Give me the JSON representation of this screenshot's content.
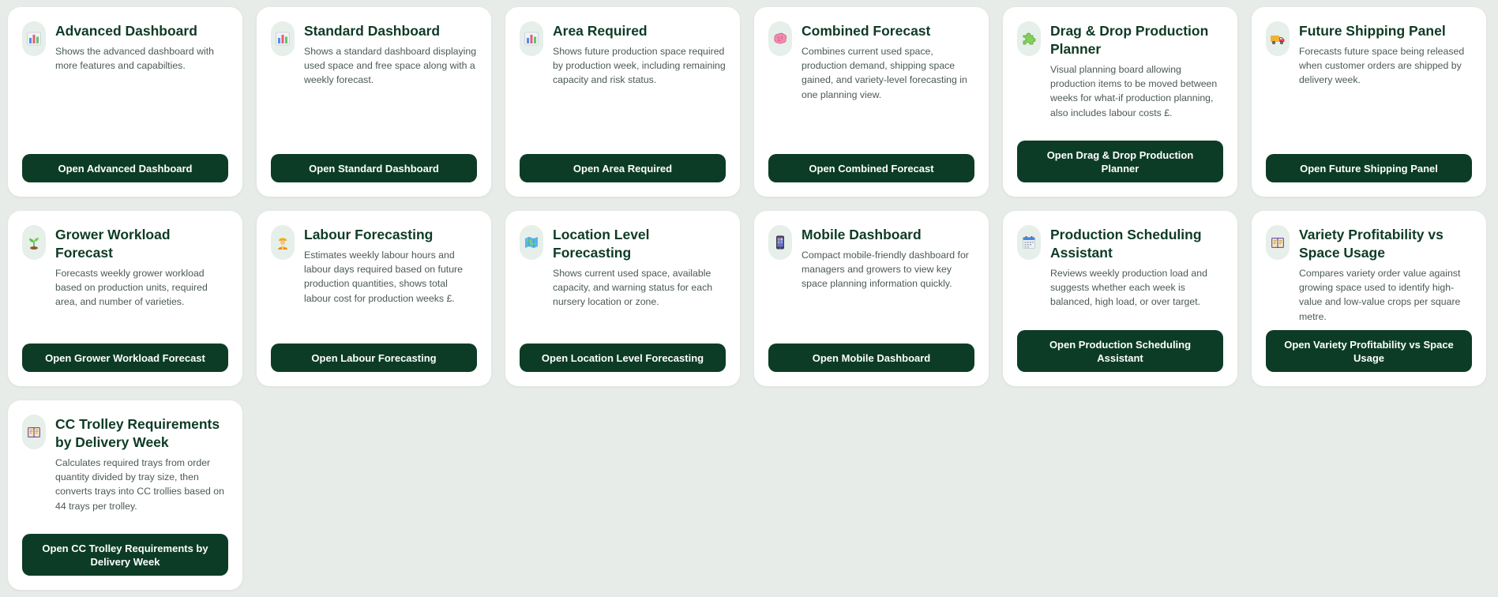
{
  "cards": [
    {
      "icon": "bar-chart-icon",
      "title": "Advanced Dashboard",
      "description": "Shows the advanced dashboard with more features and capabilties.",
      "button": "Open Advanced Dashboard"
    },
    {
      "icon": "bar-chart-icon",
      "title": "Standard Dashboard",
      "description": "Shows a standard dashboard displaying used space and free space along with a weekly forecast.",
      "button": "Open Standard Dashboard"
    },
    {
      "icon": "bar-chart-icon",
      "title": "Area Required",
      "description": "Shows future production space required by production week, including remaining capacity and risk status.",
      "button": "Open Area Required"
    },
    {
      "icon": "brain-icon",
      "title": "Combined Forecast",
      "description": "Combines current used space, production demand, shipping space gained, and variety-level forecasting in one planning view.",
      "button": "Open Combined Forecast"
    },
    {
      "icon": "puzzle-icon",
      "title": "Drag & Drop Production Planner",
      "description": "Visual planning board allowing production items to be moved between weeks for what-if production planning, also includes labour costs £.",
      "button": "Open Drag & Drop Production Planner"
    },
    {
      "icon": "truck-icon",
      "title": "Future Shipping Panel",
      "description": "Forecasts future space being released when customer orders are shipped by delivery week.",
      "button": "Open Future Shipping Panel"
    },
    {
      "icon": "seedling-icon",
      "title": "Grower Workload Forecast",
      "description": "Forecasts weekly grower workload based on production units, required area, and number of varieties.",
      "button": "Open Grower Workload Forecast"
    },
    {
      "icon": "worker-icon",
      "title": "Labour Forecasting",
      "description": "Estimates weekly labour hours and labour days required based on future production quantities, shows total labour cost for production weeks £.",
      "button": "Open Labour Forecasting"
    },
    {
      "icon": "map-icon",
      "title": "Location Level Forecasting",
      "description": "Shows current used space, available capacity, and warning status for each nursery location or zone.",
      "button": "Open Location Level Forecasting"
    },
    {
      "icon": "mobile-phone-icon",
      "title": "Mobile Dashboard",
      "description": "Compact mobile-friendly dashboard for managers and growers to view key space planning information quickly.",
      "button": "Open Mobile Dashboard"
    },
    {
      "icon": "calendar-icon",
      "title": "Production Scheduling Assistant",
      "description": "Reviews weekly production load and suggests whether each week is balanced, high load, or over target.",
      "button": "Open Production Scheduling Assistant"
    },
    {
      "icon": "ledger-icon",
      "title": "Variety Profitability vs Space Usage",
      "description": "Compares variety order value against growing space used to identify high-value and low-value crops per square metre.",
      "button": "Open Variety Profitability vs Space Usage"
    },
    {
      "icon": "ledger-icon",
      "title": "CC Trolley Requirements by Delivery Week",
      "description": "Calculates required trays from order quantity divided by tray size, then converts trays into CC trollies based on 44 trays per trolley.",
      "button": "Open CC Trolley Requirements by Delivery Week"
    }
  ],
  "colors": {
    "page_background": "#e8ece9",
    "card_background": "#ffffff",
    "title": "#0e3b25",
    "description": "#4b5a53",
    "button_background": "#0c3c26",
    "button_text": "#ffffff",
    "icon_background": "#e6efe9"
  }
}
